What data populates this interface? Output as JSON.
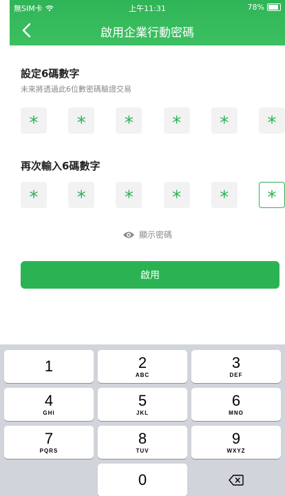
{
  "status_bar": {
    "carrier": "無SIM卡",
    "time": "上午11:31",
    "battery": "78%"
  },
  "nav": {
    "title": "啟用企業行動密碼"
  },
  "set_pin": {
    "title": "設定6碼數字",
    "subtitle": "未來將透過此6位數密碼驗證交易",
    "masks": [
      "*",
      "*",
      "*",
      "*",
      "*",
      "*"
    ]
  },
  "confirm_pin": {
    "title": "再次輸入6碼數字",
    "masks": [
      "*",
      "*",
      "*",
      "*",
      "*",
      "*"
    ],
    "active_index": 5
  },
  "show_password_label": "顯示密碼",
  "enable_button_label": "啟用",
  "keypad": {
    "keys": [
      {
        "digit": "1",
        "letters": ""
      },
      {
        "digit": "2",
        "letters": "ABC"
      },
      {
        "digit": "3",
        "letters": "DEF"
      },
      {
        "digit": "4",
        "letters": "GHI"
      },
      {
        "digit": "5",
        "letters": "JKL"
      },
      {
        "digit": "6",
        "letters": "MNO"
      },
      {
        "digit": "7",
        "letters": "PQRS"
      },
      {
        "digit": "8",
        "letters": "TUV"
      },
      {
        "digit": "9",
        "letters": "WXYZ"
      },
      {
        "digit": "0",
        "letters": ""
      }
    ],
    "delete_icon": "backspace-icon"
  },
  "colors": {
    "brand_green": "#2bb353",
    "keypad_bg": "#d1d4da"
  }
}
